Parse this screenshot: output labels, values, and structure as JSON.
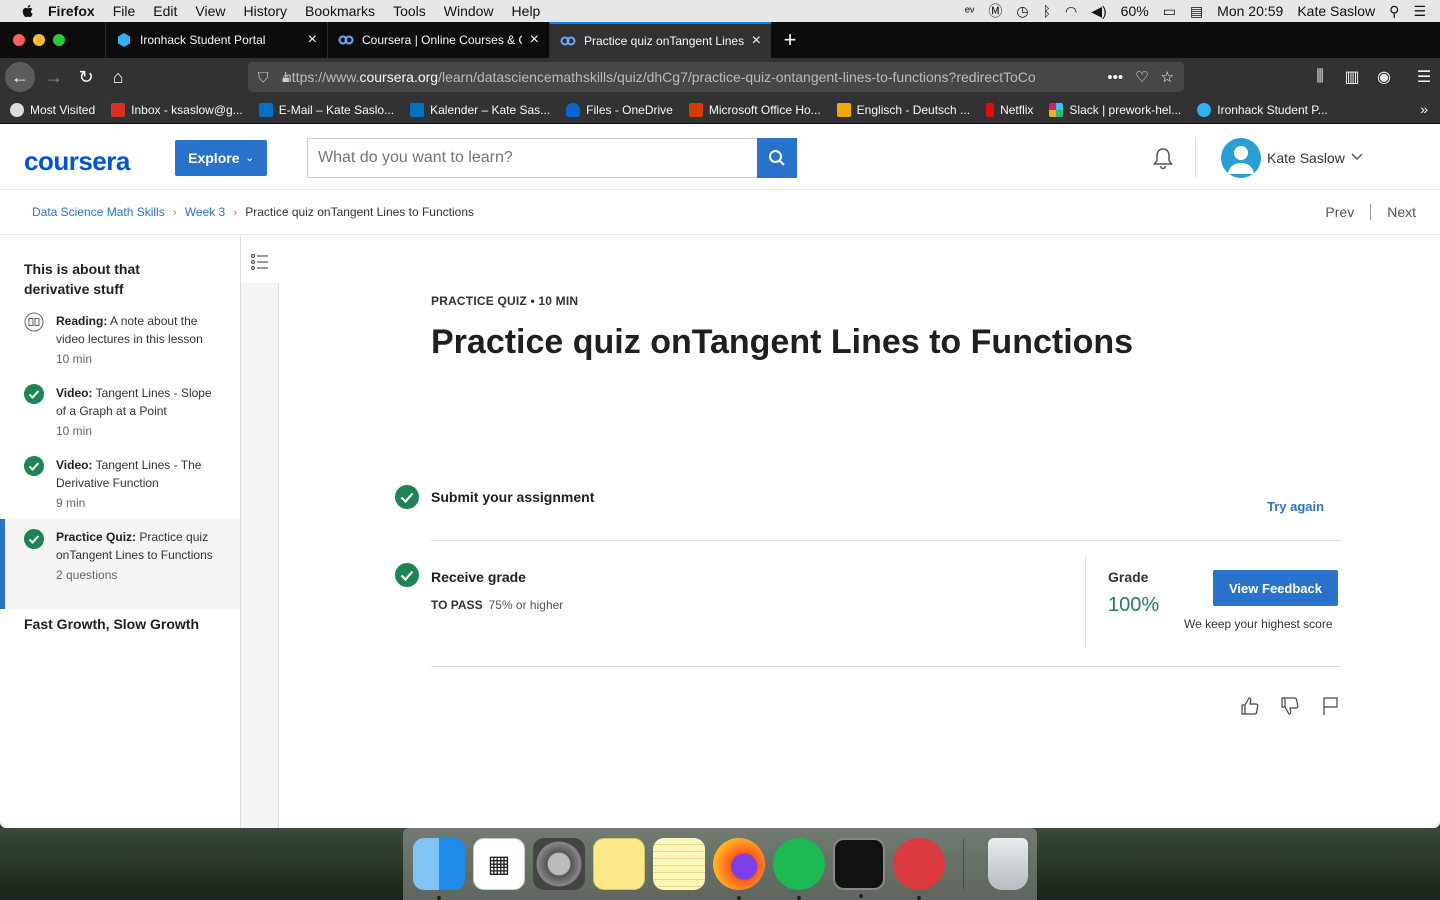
{
  "menubar": {
    "app": "Firefox",
    "items": [
      "File",
      "Edit",
      "View",
      "History",
      "Bookmarks",
      "Tools",
      "Window",
      "Help"
    ],
    "battery": "60%",
    "clock": "Mon 20:59",
    "user": "Kate Saslow"
  },
  "tabs": [
    {
      "title": "Ironhack Student Portal",
      "icon": "ironhack-icon"
    },
    {
      "title": "Coursera | Online Courses & Cr",
      "icon": "coursera-icon"
    },
    {
      "title": "Practice quiz onTangent Lines t",
      "icon": "coursera-icon",
      "active": true
    }
  ],
  "url": {
    "pre": "https://www.",
    "host": "coursera.org",
    "path": "/learn/datasciencemathskills/quiz/dhCg7/practice-quiz-ontangent-lines-to-functions?redirectToCo"
  },
  "bookmarks": [
    {
      "label": "Most Visited",
      "color": "#e8e8e8"
    },
    {
      "label": "Inbox - ksaslow@g...",
      "color": "#d93025"
    },
    {
      "label": "E-Mail – Kate Saslo...",
      "color": "#0072c6"
    },
    {
      "label": "Kalender – Kate Sas...",
      "color": "#0072c6"
    },
    {
      "label": "Files - OneDrive",
      "color": "#0a64d6"
    },
    {
      "label": "Microsoft Office Ho...",
      "color": "#d83b01"
    },
    {
      "label": "Englisch - Deutsch ...",
      "color": "#f2a900"
    },
    {
      "label": "Netflix",
      "color": "#e50914"
    },
    {
      "label": "Slack | prework-hel...",
      "color": "#4a154b"
    },
    {
      "label": "Ironhack Student P...",
      "color": "#32b1f0"
    }
  ],
  "header": {
    "logo": "coursera",
    "explore": "Explore",
    "search_placeholder": "What do you want to learn?",
    "user_name": "Kate Saslow"
  },
  "breadcrumb": {
    "course": "Data Science Math Skills",
    "week": "Week 3",
    "current": "Practice quiz onTangent Lines to Functions",
    "prev": "Prev",
    "next": "Next"
  },
  "sidebar": {
    "lesson_title": "This is about that derivative stuff",
    "items": [
      {
        "type": "Reading:",
        "title": "A note about the video lectures in this lesson",
        "meta": "10 min",
        "icon": "book-icon"
      },
      {
        "type": "Video:",
        "title": "Tangent Lines - Slope of a Graph at a Point",
        "meta": "10 min",
        "icon": "check-icon"
      },
      {
        "type": "Video:",
        "title": "Tangent Lines - The Derivative Function",
        "meta": "9 min",
        "icon": "check-icon"
      },
      {
        "type": "Practice Quiz:",
        "title": "Practice quiz onTangent Lines to Functions",
        "meta": "2 questions",
        "icon": "check-icon"
      }
    ],
    "next_lesson": "Fast Growth, Slow Growth"
  },
  "quiz": {
    "kicker": "PRACTICE QUIZ • 10 MIN",
    "title": "Practice quiz onTangent Lines to Functions",
    "step1": "Submit your assignment",
    "try_again": "Try again",
    "step2": "Receive grade",
    "to_pass_label": "TO PASS",
    "to_pass_value": "75% or higher",
    "grade_label": "Grade",
    "grade_value": "100%",
    "view_feedback": "View Feedback",
    "keep_note": "We keep your highest score"
  },
  "colors": {
    "accent": "#2a73cc",
    "brand": "#0056d2",
    "success": "#1f8354"
  }
}
